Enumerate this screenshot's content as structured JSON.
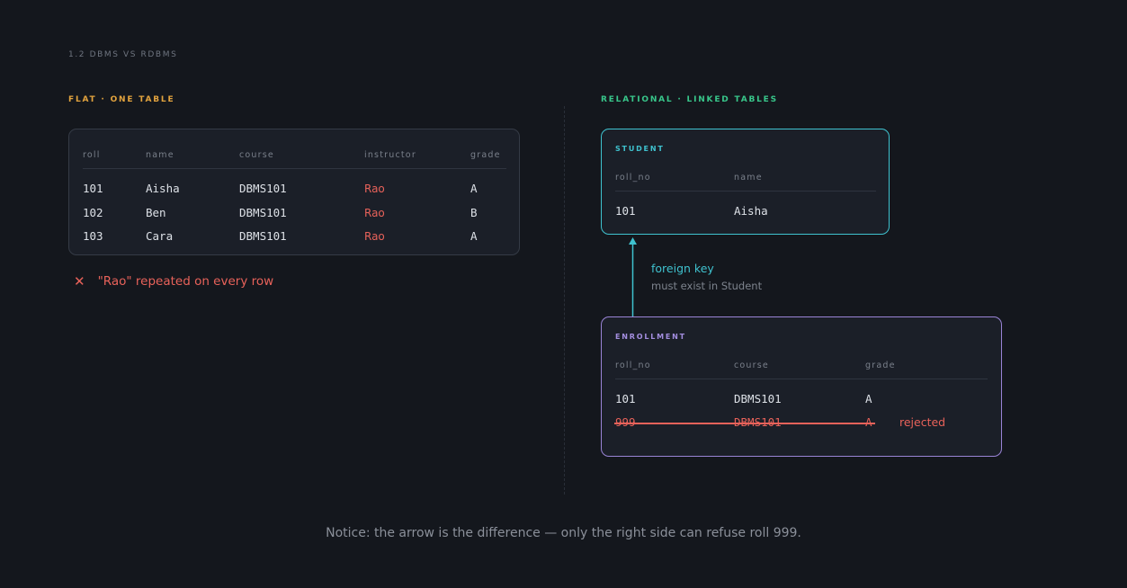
{
  "section_label": "1.2  DBMS VS RDBMS",
  "flat": {
    "title": "FLAT  ·  ONE TABLE",
    "headers": [
      "roll",
      "name",
      "course",
      "instructor",
      "grade"
    ],
    "rows": [
      [
        "101",
        "Aisha",
        "DBMS101",
        "Rao",
        "A"
      ],
      [
        "102",
        "Ben",
        "DBMS101",
        "Rao",
        "B"
      ],
      [
        "103",
        "Cara",
        "DBMS101",
        "Rao",
        "A"
      ]
    ],
    "warning_icon": "close-x-icon",
    "warning": "\"Rao\" repeated on every row"
  },
  "relational": {
    "title": "RELATIONAL  ·  LINKED TABLES",
    "student": {
      "title": "STUDENT",
      "headers": [
        "roll_no",
        "name"
      ],
      "rows": [
        [
          "101",
          "Aisha"
        ]
      ]
    },
    "foreign_key": {
      "label": "foreign key",
      "sub": "must exist in Student"
    },
    "enrollment": {
      "title": "ENROLLMENT",
      "headers": [
        "roll_no",
        "course",
        "grade"
      ],
      "rows": [
        [
          "101",
          "DBMS101",
          "A"
        ]
      ],
      "rejected_row": [
        "999",
        "DBMS101",
        "A"
      ],
      "rejected_label": "rejected"
    }
  },
  "notice": "Notice: the arrow is the difference — only the right side can refuse roll 999.",
  "colors": {
    "flat_accent": "#e2a33e",
    "relational_accent": "#38c68a",
    "student_border": "#3fc2cf",
    "enrollment_border": "#9a84d6",
    "error": "#e8625a"
  }
}
